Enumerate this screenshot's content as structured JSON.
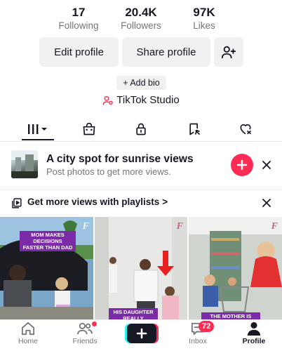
{
  "stats": [
    {
      "value": "17",
      "label": "Following"
    },
    {
      "value": "20.4K",
      "label": "Followers"
    },
    {
      "value": "97K",
      "label": "Likes"
    }
  ],
  "actions": {
    "edit_profile": "Edit profile",
    "share_profile": "Share profile",
    "add_friend_icon": "person-plus-icon"
  },
  "bio": {
    "add_bio": "+ Add bio"
  },
  "studio": {
    "label": "TikTok Studio",
    "icon": "studio-person-icon"
  },
  "tabs": [
    {
      "icon": "videos-grid-icon",
      "active": true
    },
    {
      "icon": "shop-bag-icon",
      "active": false
    },
    {
      "icon": "lock-icon",
      "active": false
    },
    {
      "icon": "bookmark-flag-icon",
      "active": false
    },
    {
      "icon": "liked-heart-icon",
      "active": false
    }
  ],
  "promo": {
    "title": "A city spot for sunrise views",
    "subtitle": "Post photos to get more views."
  },
  "playlist": {
    "text": "Get more views with playlists >"
  },
  "videos": [
    {
      "caption": "MOM MAKES DECISIONS FASTER THAN DAD",
      "logo": "F"
    },
    {
      "caption": "HIS DAUGHTER REALLY",
      "logo": "F"
    },
    {
      "caption": "THE MOTHER IS IGNORING",
      "logo": "F"
    }
  ],
  "nav": {
    "home": "Home",
    "friends": "Friends",
    "inbox": "Inbox",
    "inbox_badge": "72",
    "profile": "Profile"
  },
  "colors": {
    "accent": "#fe2c55",
    "text": "#161823",
    "muted": "#73757b",
    "button_bg": "#f1f1f2"
  }
}
